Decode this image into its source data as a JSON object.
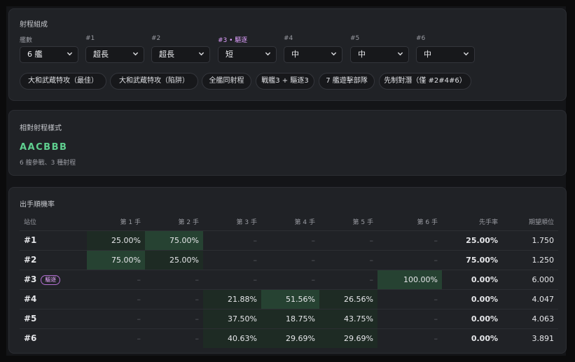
{
  "composition": {
    "title": "射程組成",
    "fields": [
      {
        "label": "艦數",
        "value": "6 艦",
        "pink": false
      },
      {
        "label": "#1",
        "value": "超長",
        "pink": false
      },
      {
        "label": "#2",
        "value": "超長",
        "pink": false
      },
      {
        "label": "#3 • 驅逐",
        "value": "短",
        "pink": true
      },
      {
        "label": "#4",
        "value": "中",
        "pink": false
      },
      {
        "label": "#5",
        "value": "中",
        "pink": false
      },
      {
        "label": "#6",
        "value": "中",
        "pink": false
      }
    ],
    "presets": [
      "大和武蔵特攻（最佳）",
      "大和武蔵特攻（陷阱）",
      "全艦同射程",
      "戰艦3 + 驅逐3",
      "7 艦遊擊部隊",
      "先制對潛（僅 #2#4#6）"
    ]
  },
  "relative": {
    "title": "相對射程樣式",
    "pattern": "AACBBB",
    "subtitle": "6 艘參戰、3 種射程"
  },
  "order": {
    "title": "出手順機率",
    "headers": [
      "站位",
      "第 1 手",
      "第 2 手",
      "第 3 手",
      "第 4 手",
      "第 5 手",
      "第 6 手",
      "先手率",
      "期望順位"
    ],
    "rows": [
      {
        "pos": "#1",
        "tag": "",
        "cells": [
          "25.00%",
          "75.00%",
          "–",
          "–",
          "–",
          "–"
        ],
        "first": "25.00%",
        "expected": "1.750"
      },
      {
        "pos": "#2",
        "tag": "",
        "cells": [
          "75.00%",
          "25.00%",
          "–",
          "–",
          "–",
          "–"
        ],
        "first": "75.00%",
        "expected": "1.250"
      },
      {
        "pos": "#3",
        "tag": "驅逐",
        "cells": [
          "–",
          "–",
          "–",
          "–",
          "–",
          "100.00%"
        ],
        "first": "0.00%",
        "expected": "6.000"
      },
      {
        "pos": "#4",
        "tag": "",
        "cells": [
          "–",
          "–",
          "21.88%",
          "51.56%",
          "26.56%",
          "–"
        ],
        "first": "0.00%",
        "expected": "4.047"
      },
      {
        "pos": "#5",
        "tag": "",
        "cells": [
          "–",
          "–",
          "37.50%",
          "18.75%",
          "43.75%",
          "–"
        ],
        "first": "0.00%",
        "expected": "4.063"
      },
      {
        "pos": "#6",
        "tag": "",
        "cells": [
          "–",
          "–",
          "40.63%",
          "29.69%",
          "29.69%",
          "–"
        ],
        "first": "0.00%",
        "expected": "3.891"
      }
    ]
  }
}
